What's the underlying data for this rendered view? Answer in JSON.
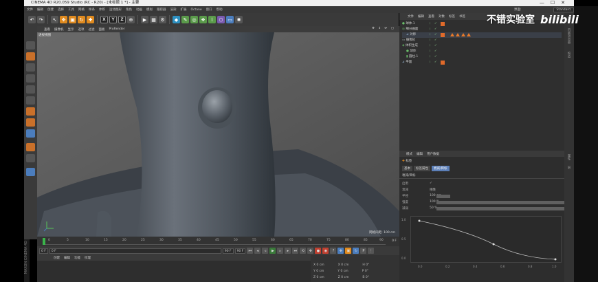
{
  "window": {
    "title": "CINEMA 4D R20.059 Studio (RC - R20) - [未标题 1 *] - 主要"
  },
  "menubar": {
    "items": [
      "文件",
      "编辑",
      "创建",
      "选择",
      "工具",
      "网格",
      "样条",
      "体积",
      "运动图形",
      "角色",
      "动画",
      "模拟",
      "跟踪器",
      "渲染",
      "扩展",
      "Octane",
      "窗口",
      "帮助"
    ],
    "layout_label": "界面:",
    "layout_value": "Standard"
  },
  "toolbar": {
    "axis_x": "X",
    "axis_y": "Y",
    "axis_z": "Z"
  },
  "viewport": {
    "menu": [
      "查看",
      "摄像机",
      "显示",
      "选项",
      "过滤",
      "面板",
      "ProRender"
    ],
    "label": "透视视图",
    "status": "网格间距: 100 cm"
  },
  "timeline": {
    "ticks": [
      "0",
      "5",
      "10",
      "15",
      "20",
      "25",
      "30",
      "35",
      "40",
      "45",
      "50",
      "55",
      "60",
      "65",
      "70",
      "75",
      "80",
      "85",
      "90"
    ],
    "end_label": "0 F",
    "start_field": "0 F",
    "current_field": "0 F",
    "end_field": "90 F",
    "end_field2": "90 F"
  },
  "material": {
    "menu": [
      "创建",
      "编辑",
      "功能",
      "纹理"
    ]
  },
  "coords": {
    "rows": [
      {
        "a": "X",
        "av": "0 cm",
        "b": "X",
        "bv": "0 cm",
        "c": "H",
        "cv": "0°"
      },
      {
        "a": "Y",
        "av": "0 cm",
        "b": "Y",
        "bv": "0 cm",
        "c": "P",
        "cv": "0°"
      },
      {
        "a": "Z",
        "av": "0 cm",
        "b": "Z",
        "bv": "0 cm",
        "c": "B",
        "cv": "0°"
      }
    ]
  },
  "brand_strip": "MAXON CINEMA 4D",
  "objects": {
    "header": [
      "文件",
      "编辑",
      "查看",
      "对象",
      "标签",
      "书签"
    ],
    "rows": [
      {
        "name": "球体.1"
      },
      {
        "name": "细分曲面"
      },
      {
        "name": "对称"
      },
      {
        "name": "摄像机"
      },
      {
        "name": "体积生成"
      },
      {
        "name": "球体"
      },
      {
        "name": "圆柱.1"
      },
      {
        "name": "平面"
      }
    ]
  },
  "attributes": {
    "header": [
      "模式",
      "编辑",
      "用户数据"
    ],
    "subtitle": "标签",
    "tabs": [
      "基本",
      "标签属性",
      "衰减/目标"
    ],
    "active_tab": "衰减/目标",
    "section": "衰减/目标",
    "rows": [
      {
        "label": "启用",
        "value": "✓"
      },
      {
        "label": "衰减",
        "value": "线性"
      },
      {
        "label": "半径",
        "value": "100 cm"
      },
      {
        "label": "强度",
        "value": "100 %"
      },
      {
        "label": "减弱",
        "value": "50 %"
      }
    ],
    "graph_x": [
      "0.0",
      "0.2",
      "0.4",
      "0.6",
      "0.8",
      "1.0"
    ],
    "graph_y": [
      "1.0",
      "0.5",
      "0.0"
    ]
  },
  "right_strip": [
    "对象",
    "内容浏览器",
    "构造",
    "属性",
    "层"
  ],
  "watermark": {
    "text": "不错实验室",
    "logo": "bilibili"
  },
  "colors": {
    "accent_orange": "#e08a1e",
    "selection_blue": "#5c7fb8",
    "viewport_bg": "#5a5a5a",
    "panel_bg": "#2f2f2f"
  }
}
